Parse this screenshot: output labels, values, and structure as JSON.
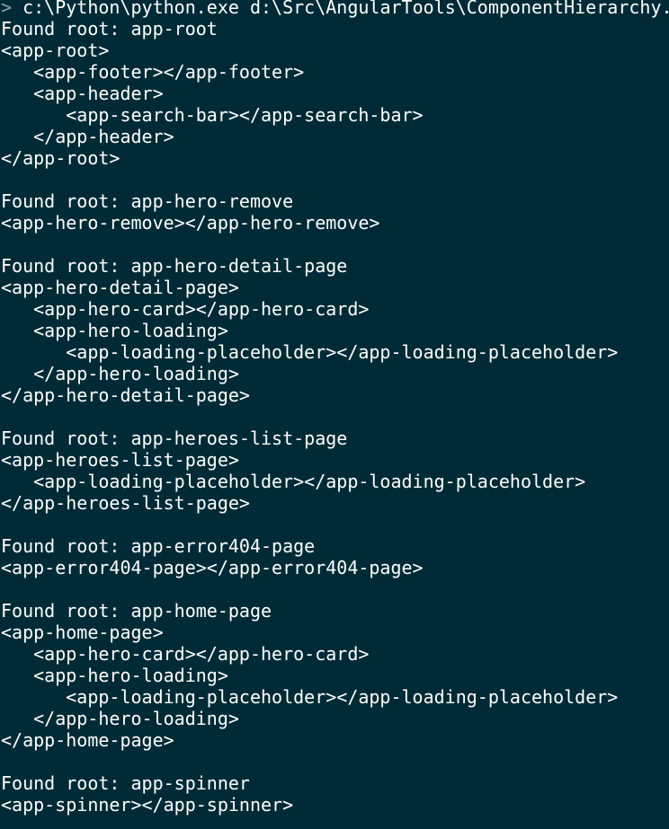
{
  "terminal": {
    "background": "#002b36",
    "foreground": "#ffffff",
    "prompt": {
      "symbol": ">",
      "command": " c:\\Python\\python.exe d:\\Src\\AngularTools\\ComponentHierarchy."
    },
    "lines": [
      "Found root: app-root",
      "<app-root>",
      "   <app-footer></app-footer>",
      "   <app-header>",
      "      <app-search-bar></app-search-bar>",
      "   </app-header>",
      "</app-root>",
      "",
      "Found root: app-hero-remove",
      "<app-hero-remove></app-hero-remove>",
      "",
      "Found root: app-hero-detail-page",
      "<app-hero-detail-page>",
      "   <app-hero-card></app-hero-card>",
      "   <app-hero-loading>",
      "      <app-loading-placeholder></app-loading-placeholder>",
      "   </app-hero-loading>",
      "</app-hero-detail-page>",
      "",
      "Found root: app-heroes-list-page",
      "<app-heroes-list-page>",
      "   <app-loading-placeholder></app-loading-placeholder>",
      "</app-heroes-list-page>",
      "",
      "Found root: app-error404-page",
      "<app-error404-page></app-error404-page>",
      "",
      "Found root: app-home-page",
      "<app-home-page>",
      "   <app-hero-card></app-hero-card>",
      "   <app-hero-loading>",
      "      <app-loading-placeholder></app-loading-placeholder>",
      "   </app-hero-loading>",
      "</app-home-page>",
      "",
      "Found root: app-spinner",
      "<app-spinner></app-spinner>"
    ]
  }
}
